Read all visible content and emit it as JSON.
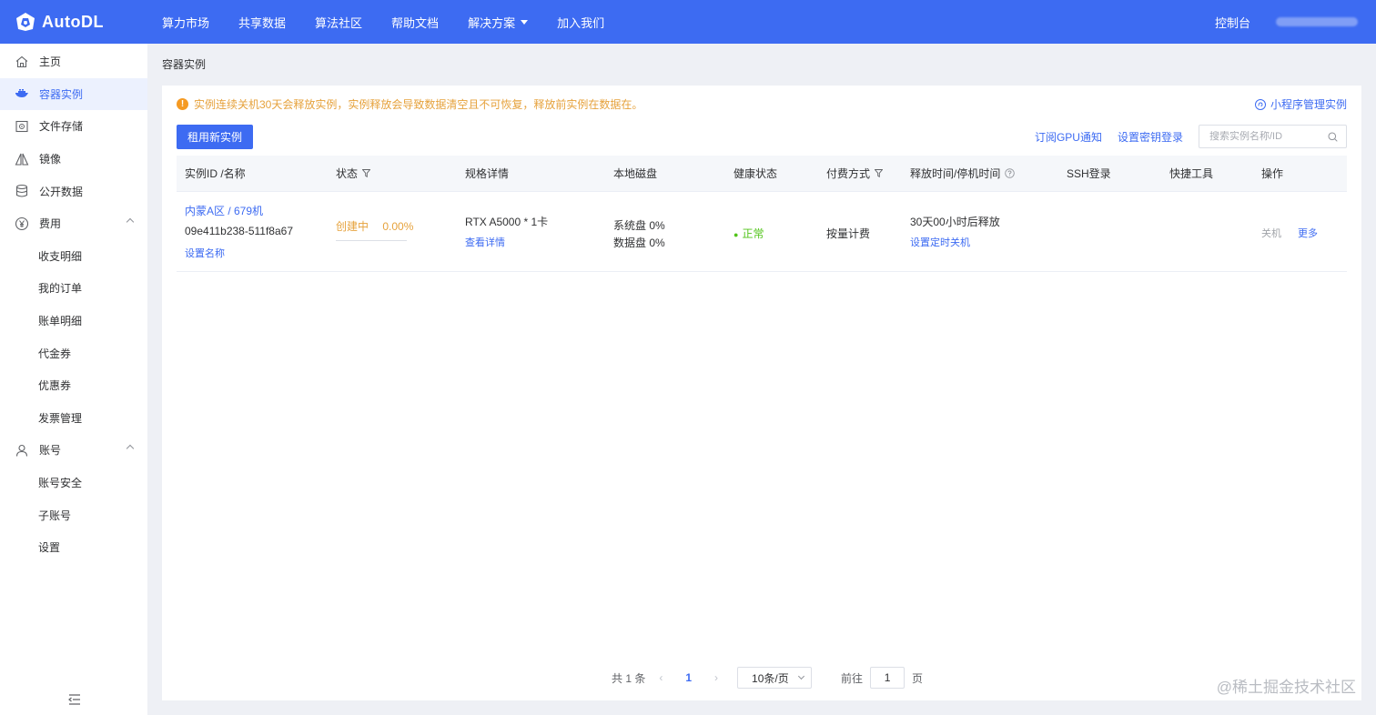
{
  "topbar": {
    "logo_text": "AutoDL",
    "nav": [
      {
        "label": "算力市场"
      },
      {
        "label": "共享数据"
      },
      {
        "label": "算法社区"
      },
      {
        "label": "帮助文档"
      },
      {
        "label": "解决方案",
        "has_dropdown": true
      },
      {
        "label": "加入我们"
      }
    ],
    "console": "控制台"
  },
  "sidebar": {
    "items": [
      {
        "label": "主页",
        "icon": "home-icon"
      },
      {
        "label": "容器实例",
        "icon": "container-icon",
        "active": true
      },
      {
        "label": "文件存储",
        "icon": "storage-icon"
      },
      {
        "label": "镜像",
        "icon": "mirror-icon"
      },
      {
        "label": "公开数据",
        "icon": "database-icon"
      },
      {
        "label": "费用",
        "icon": "yen-icon",
        "expanded": true
      },
      {
        "label": "收支明细",
        "sub": true
      },
      {
        "label": "我的订单",
        "sub": true
      },
      {
        "label": "账单明细",
        "sub": true
      },
      {
        "label": "代金券",
        "sub": true
      },
      {
        "label": "优惠券",
        "sub": true
      },
      {
        "label": "发票管理",
        "sub": true
      },
      {
        "label": "账号",
        "icon": "user-icon",
        "expanded": true
      },
      {
        "label": "账号安全",
        "sub": true
      },
      {
        "label": "子账号",
        "sub": true
      },
      {
        "label": "设置",
        "sub": true
      }
    ]
  },
  "breadcrumb": "容器实例",
  "alert": "实例连续关机30天会释放实例，实例释放会导致数据清空且不可恢复，释放前实例在数据在。",
  "mini_program_manage": "小程序管理实例",
  "rent_button": "租用新实例",
  "toolbar": {
    "subscribe_gpu": "订阅GPU通知",
    "set_key_login": "设置密钥登录",
    "search_placeholder": "搜索实例名称/ID"
  },
  "table": {
    "headers": [
      "实例ID /名称",
      "状态",
      "规格详情",
      "本地磁盘",
      "健康状态",
      "付费方式",
      "释放时间/停机时间",
      "SSH登录",
      "快捷工具",
      "操作"
    ],
    "rows": [
      {
        "region_name": "内蒙A区 / 679机",
        "instance_id": "09e411b238-511f8a67",
        "set_name": "设置名称",
        "status": "创建中",
        "progress": "0.00%",
        "spec": "RTX A5000 * 1卡",
        "view_detail": "查看详情",
        "system_disk": "系统盘 0%",
        "data_disk": "数据盘 0%",
        "health": "正常",
        "billing": "按量计费",
        "release_time": "30天00小时后释放",
        "set_timer_shutdown": "设置定时关机",
        "action_shutdown": "关机",
        "action_more": "更多"
      }
    ]
  },
  "pagination": {
    "total": "共 1 条",
    "current_page": "1",
    "page_size": "10条/页",
    "goto_label": "前往",
    "goto_value": "1",
    "page_suffix": "页"
  },
  "watermark": "@稀土掘金技术社区",
  "colors": {
    "brand": "#3d6bf2",
    "warning": "#e6a23c",
    "success": "#52c41a"
  }
}
